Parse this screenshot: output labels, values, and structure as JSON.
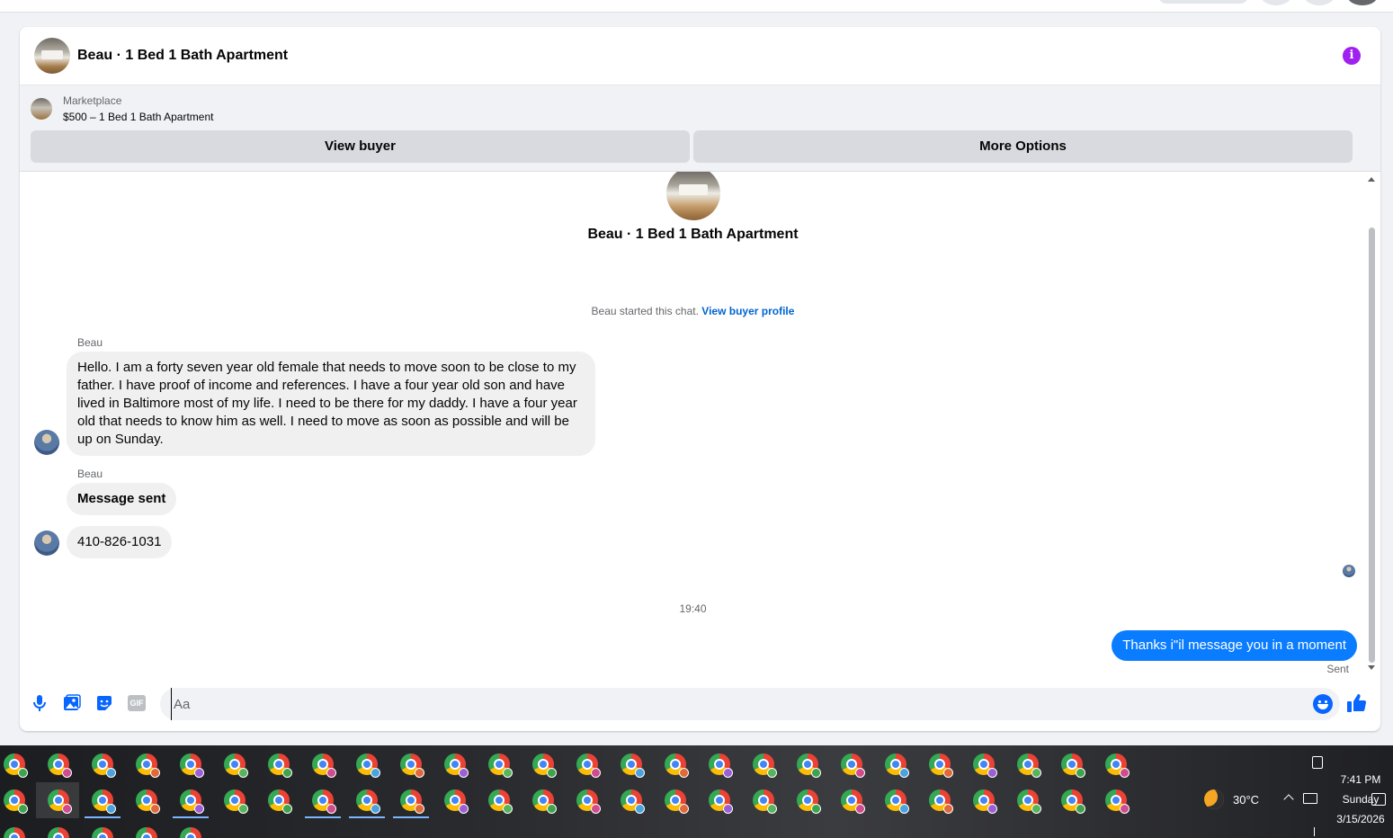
{
  "header": {
    "title": "Beau · 1 Bed 1 Bath Apartment"
  },
  "marketplace": {
    "label": "Marketplace",
    "listing": "$500 – 1 Bed 1 Bath Apartment",
    "view_buyer": "View buyer",
    "more_options": "More Options"
  },
  "conversation": {
    "intro_title": "Beau · 1 Bed 1 Bath Apartment",
    "started_text": "Beau started this chat.",
    "started_link": "View buyer profile",
    "messages": [
      {
        "sender": "Beau",
        "text": "Hello.  I am a forty seven year old female that needs to move soon to be close to my father.  I have proof of income and references.  I have a four year old son and have lived in Baltimore most of my life.  I need to be there for my daddy.  I have a four year old that needs to know him as well.  I need to move as soon as possible and will be up on Sunday."
      },
      {
        "sender": "Beau",
        "text": "Message sent"
      },
      {
        "sender": "",
        "text": "410-826-1031"
      }
    ],
    "timestamp": "19:40",
    "outgoing": {
      "text": "Thanks i\"il message you in a moment",
      "status": "Sent"
    }
  },
  "composer": {
    "placeholder": "Aa",
    "gif_label": "GIF"
  },
  "taskbar": {
    "weather": "30°C",
    "time": "7:41 PM",
    "day": "Sunday",
    "date": "3/15/2026"
  },
  "colors": {
    "accent": "#0866ff",
    "outgoing_bubble": "#0a7cff",
    "info_icon": "#a020f0"
  }
}
